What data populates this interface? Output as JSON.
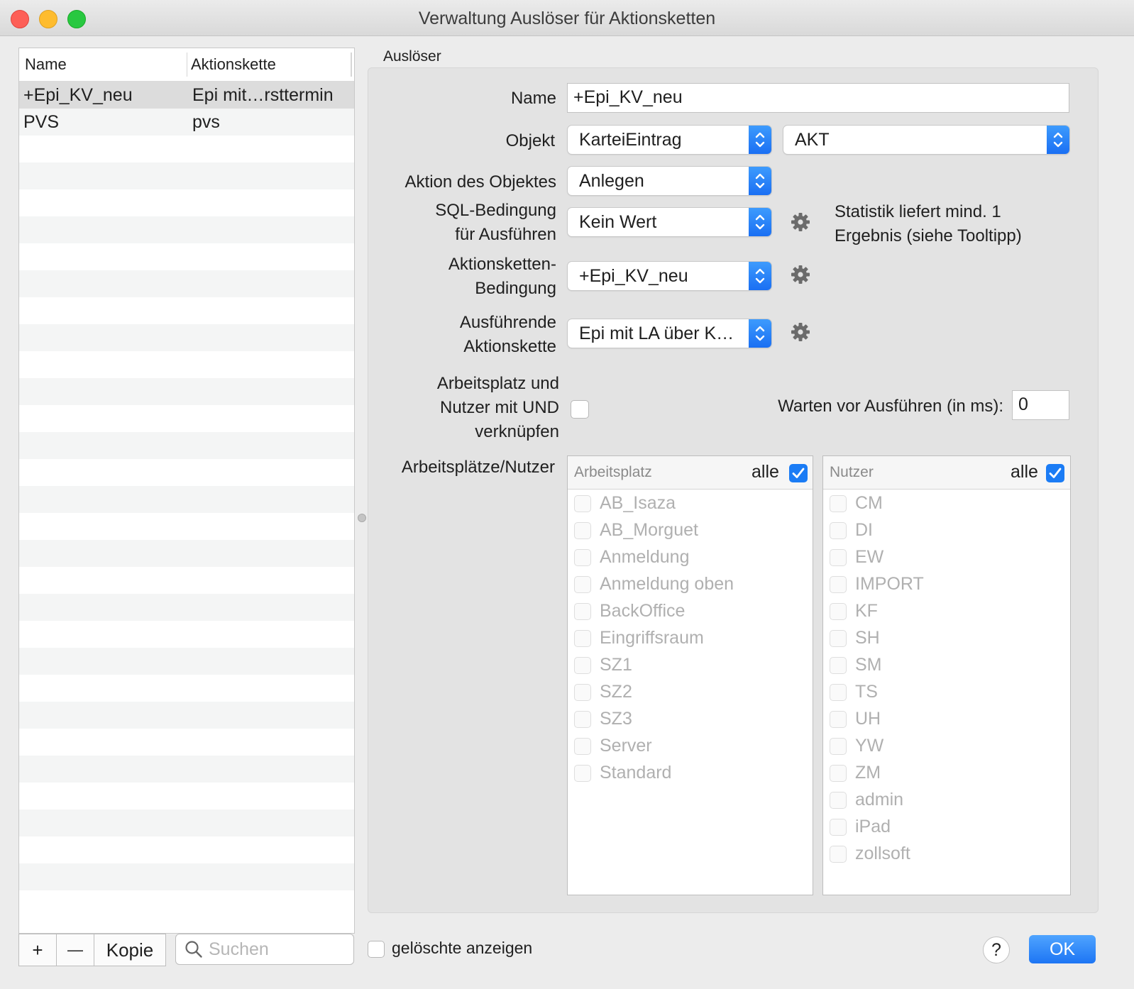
{
  "window": {
    "title": "Verwaltung Auslöser für Aktionsketten"
  },
  "list": {
    "columns": [
      "Name",
      "Aktionskette"
    ],
    "rows": [
      {
        "name": "+Epi_KV_neu",
        "chain": "Epi mit…rsttermin"
      },
      {
        "name": "PVS",
        "chain": "pvs"
      }
    ],
    "add_label": "+",
    "remove_label": "—",
    "copy_label": "Kopie",
    "search_placeholder": "Suchen"
  },
  "trigger": {
    "section_label": "Auslöser",
    "name_label": "Name",
    "name_value": "+Epi_KV_neu",
    "object_label": "Objekt",
    "object_value": "KarteiEintrag",
    "object_sub_value": "AKT",
    "action_label": "Aktion des Objektes",
    "action_value": "Anlegen",
    "sql_label_1": "SQL-Bedingung",
    "sql_label_2": "für Ausführen",
    "sql_value": "Kein Wert",
    "sql_hint_1": "Statistik liefert mind. 1",
    "sql_hint_2": "Ergebnis (siehe Tooltipp)",
    "chain_cond_label_1": "Aktionsketten-",
    "chain_cond_label_2": "Bedingung",
    "chain_cond_value": "+Epi_KV_neu",
    "exec_chain_label_1": "Ausführende",
    "exec_chain_label_2": "Aktionskette",
    "exec_chain_value": "Epi mit LA über K…",
    "and_label_1": "Arbeitsplatz und",
    "and_label_2": "Nutzer mit UND",
    "and_label_3": "verknüpfen",
    "and_checked": false,
    "wait_label": "Warten vor Ausführen (in ms):",
    "wait_value": "0",
    "places_users_label": "Arbeitsplätze/Nutzer"
  },
  "workplaces": {
    "title": "Arbeitsplatz",
    "all_label": "alle",
    "all_checked": true,
    "items": [
      "AB_Isaza",
      "AB_Morguet",
      "Anmeldung",
      "Anmeldung oben",
      "BackOffice",
      "Eingriffsraum",
      "SZ1",
      "SZ2",
      "SZ3",
      "Server",
      "Standard"
    ]
  },
  "users": {
    "title": "Nutzer",
    "all_label": "alle",
    "all_checked": true,
    "items": [
      "CM",
      "DI",
      "EW",
      "IMPORT",
      "KF",
      "SH",
      "SM",
      "TS",
      "UH",
      "YW",
      "ZM",
      "admin",
      "iPad",
      "zollsoft"
    ]
  },
  "footer": {
    "show_deleted_label": "gelöschte anzeigen",
    "help_label": "?",
    "ok_label": "OK"
  },
  "colors": {
    "accent": "#1b7cf5",
    "selection_row": "#dcdcdc",
    "close": "#fd5f57",
    "minimize": "#febc2e",
    "maximize": "#28c840"
  }
}
